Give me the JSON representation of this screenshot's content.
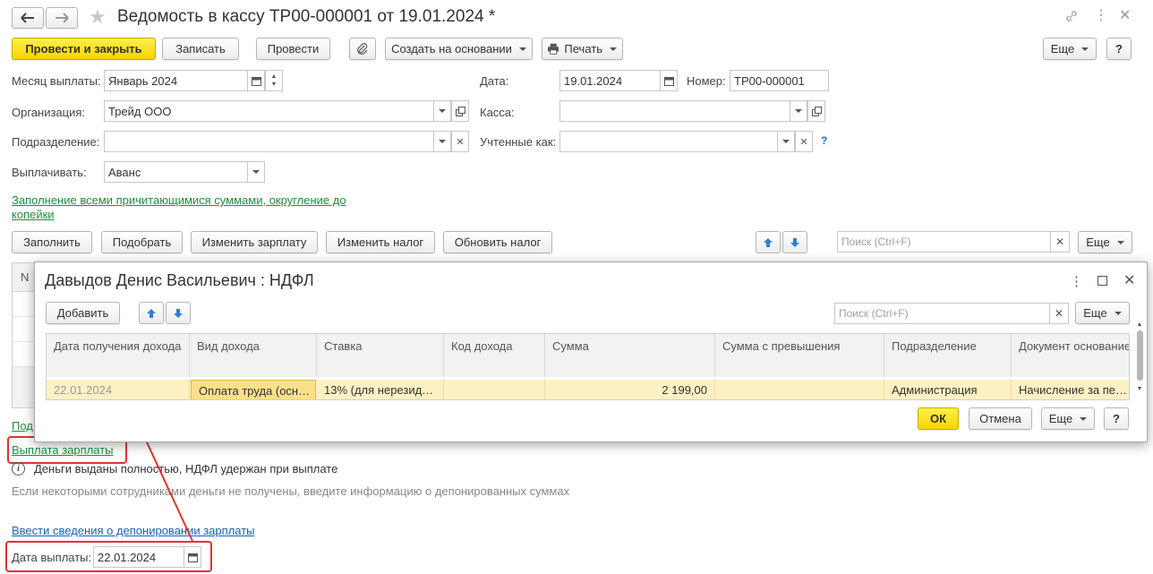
{
  "window": {
    "title": "Ведомость в кассу ТР00-000001 от 19.01.2024 *"
  },
  "toolbar": {
    "post_close": "Провести и закрыть",
    "save": "Записать",
    "post": "Провести",
    "create_based": "Создать на основании",
    "print": "Печать",
    "more": "Еще",
    "help": "?"
  },
  "form": {
    "month_label": "Месяц выплаты:",
    "month_value": "Январь 2024",
    "date_label": "Дата:",
    "date_value": "19.01.2024",
    "number_label": "Номер:",
    "number_value": "ТР00-000001",
    "org_label": "Организация:",
    "org_value": "Трейд ООО",
    "cash_label": "Касса:",
    "cash_value": "",
    "dept_label": "Подразделение:",
    "dept_value": "",
    "accounted_label": "Учтенные как:",
    "accounted_value": "",
    "pay_label": "Выплачивать:",
    "pay_value": "Аванс",
    "fill_link": "Заполнение всеми причитающимися суммами, округление до копейки"
  },
  "table_toolbar": {
    "fill": "Заполнить",
    "pick": "Подобрать",
    "change_salary": "Изменить зарплату",
    "change_tax": "Изменить налог",
    "update_tax": "Обновить налог",
    "search_placeholder": "Поиск (Ctrl+F)",
    "more": "Еще",
    "col_n": "N"
  },
  "bottom": {
    "pod_link": "Под",
    "salary_link": "Выплата зарплаты",
    "info_text": "Деньги выданы полностью, НДФЛ удержан при выплате",
    "hint_text": "Если некоторыми сотрудниками деньги не получены, введите информацию о депонированных суммах",
    "deposit_link": "Ввести сведения о депонировании зарплаты",
    "paydate_label": "Дата выплаты:",
    "paydate_value": "22.01.2024"
  },
  "dialog": {
    "title": "Давыдов Денис Васильевич : НДФЛ",
    "add": "Добавить",
    "search_placeholder": "Поиск (Ctrl+F)",
    "more": "Еще",
    "columns": [
      "Дата получения дохода",
      "Вид дохода",
      "Ставка",
      "Код дохода",
      "Сумма",
      "Сумма с превышения",
      "Подразделение",
      "Документ основание"
    ],
    "row": [
      "22.01.2024",
      "Оплата труда (осн…",
      "13% (для нерезид…",
      "",
      "2 199,00",
      "",
      "Администрация",
      "Начисление за пе…"
    ],
    "ok": "ОК",
    "cancel": "Отмена",
    "more2": "Еще",
    "help": "?"
  },
  "colors": {
    "accent_yellow": "#f5d400",
    "link_green": "#1c8f3c",
    "annotation_red": "#e0332f",
    "row_highlight": "#fdf1c4"
  }
}
